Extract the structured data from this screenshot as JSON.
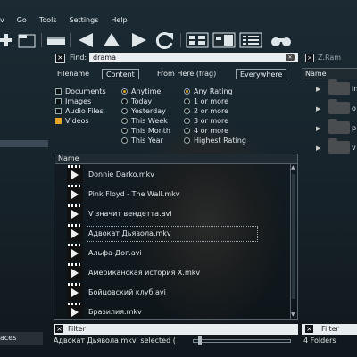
{
  "menu": [
    "v",
    "Go",
    "Tools",
    "Settings",
    "Help"
  ],
  "left_panel": {
    "bottom_label": "aces"
  },
  "search": {
    "find_label": "Find:",
    "query": "drama",
    "filename_label": "Filename",
    "content_button": "Content",
    "from_here_label": "From Here (frag)",
    "everywhere_button": "Everywhere"
  },
  "types": [
    {
      "label": "Documents",
      "checked": false
    },
    {
      "label": "Images",
      "checked": false
    },
    {
      "label": "Audio Files",
      "checked": false
    },
    {
      "label": "Videos",
      "checked": true
    }
  ],
  "time": [
    {
      "label": "Anytime",
      "selected": true
    },
    {
      "label": "Today",
      "selected": false
    },
    {
      "label": "Yesterday",
      "selected": false
    },
    {
      "label": "This Week",
      "selected": false
    },
    {
      "label": "This Month",
      "selected": false
    },
    {
      "label": "This Year",
      "selected": false
    }
  ],
  "rating": [
    {
      "label": "Any Rating",
      "selected": true
    },
    {
      "label": "1 or more",
      "selected": false
    },
    {
      "label": "2 or more",
      "selected": false
    },
    {
      "label": "3 or more",
      "selected": false
    },
    {
      "label": "4 or more",
      "selected": false
    },
    {
      "label": "Highest Rating",
      "selected": false
    }
  ],
  "results": {
    "column_name": "Name",
    "files": [
      "Donnie Darko.mkv",
      "Pink Floyd - The Wall.mkv",
      "V значит вендетта.avi",
      "Адвокат Дьявола.mkv",
      "Альфа-Дог.avi",
      "Американская история X.mkv",
      "Бойцовский клуб.avi",
      "Бразилия.mkv"
    ],
    "selected_index": 3
  },
  "filter": {
    "label": "Filter"
  },
  "status": {
    "text": "Адвокат Дьявола.mkv' selected (",
    "folders": "4 Folders"
  },
  "right_panel": {
    "find_label": "Z.Ram",
    "column_name": "Name",
    "folders": [
      "in",
      "o",
      "p",
      "v"
    ],
    "filter_label": "Filter"
  }
}
